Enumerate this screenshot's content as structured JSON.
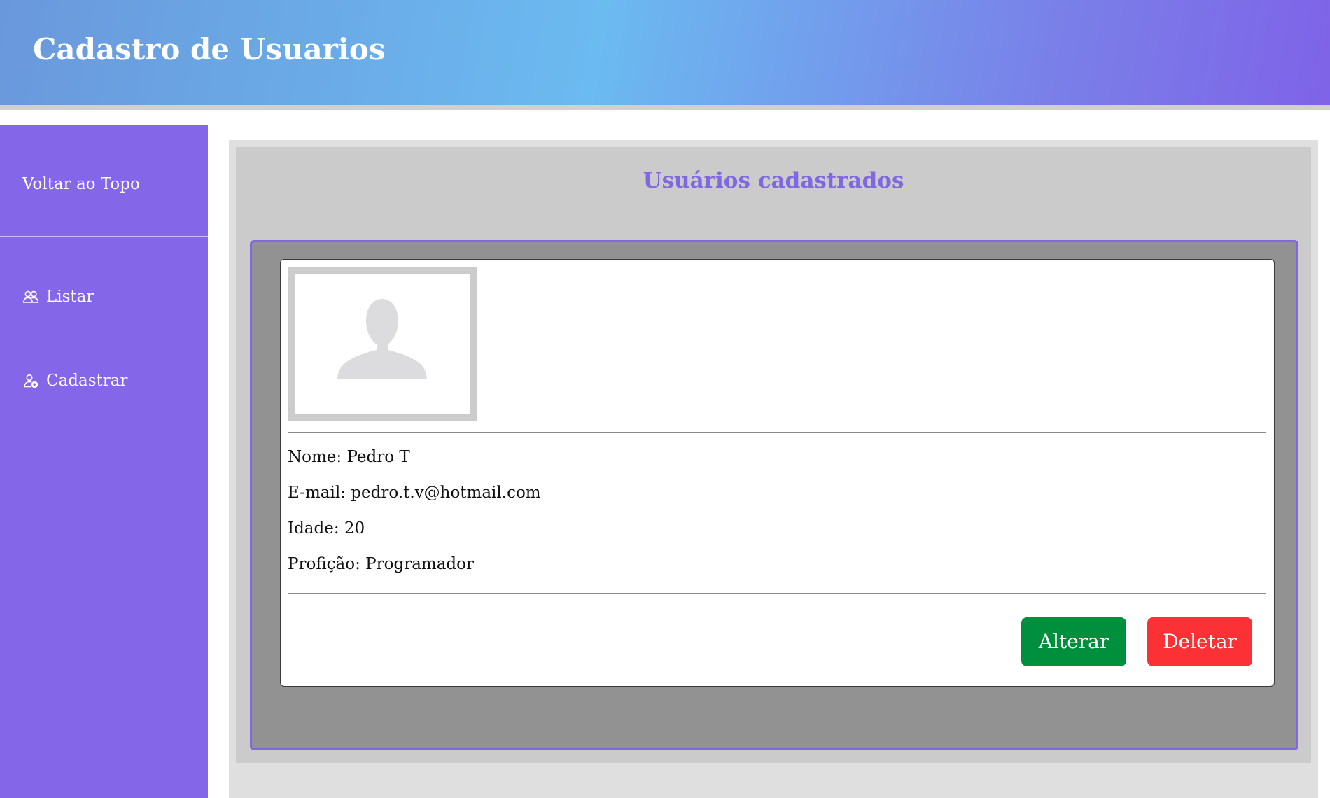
{
  "header": {
    "title": "Cadastro de Usuarios"
  },
  "sidebar": {
    "back_to_top": "Voltar ao Topo",
    "items": [
      {
        "label": "Listar",
        "icon": "users-icon"
      },
      {
        "label": "Cadastrar",
        "icon": "user-add-icon"
      }
    ]
  },
  "main": {
    "title": "Usuários cadastrados",
    "user": {
      "name_line": "Nome: Pedro T",
      "email_line": "E-mail: pedro.t.v@hotmail.com",
      "age_line": "Idade: 20",
      "profession_line": "Profição: Programador",
      "avatar_icon": "user-placeholder-icon"
    },
    "buttons": {
      "edit_label": "Alterar",
      "delete_label": "Deletar"
    }
  },
  "colors": {
    "accent": "#8367e8",
    "edit": "#008f3c",
    "delete": "#fb3136"
  }
}
